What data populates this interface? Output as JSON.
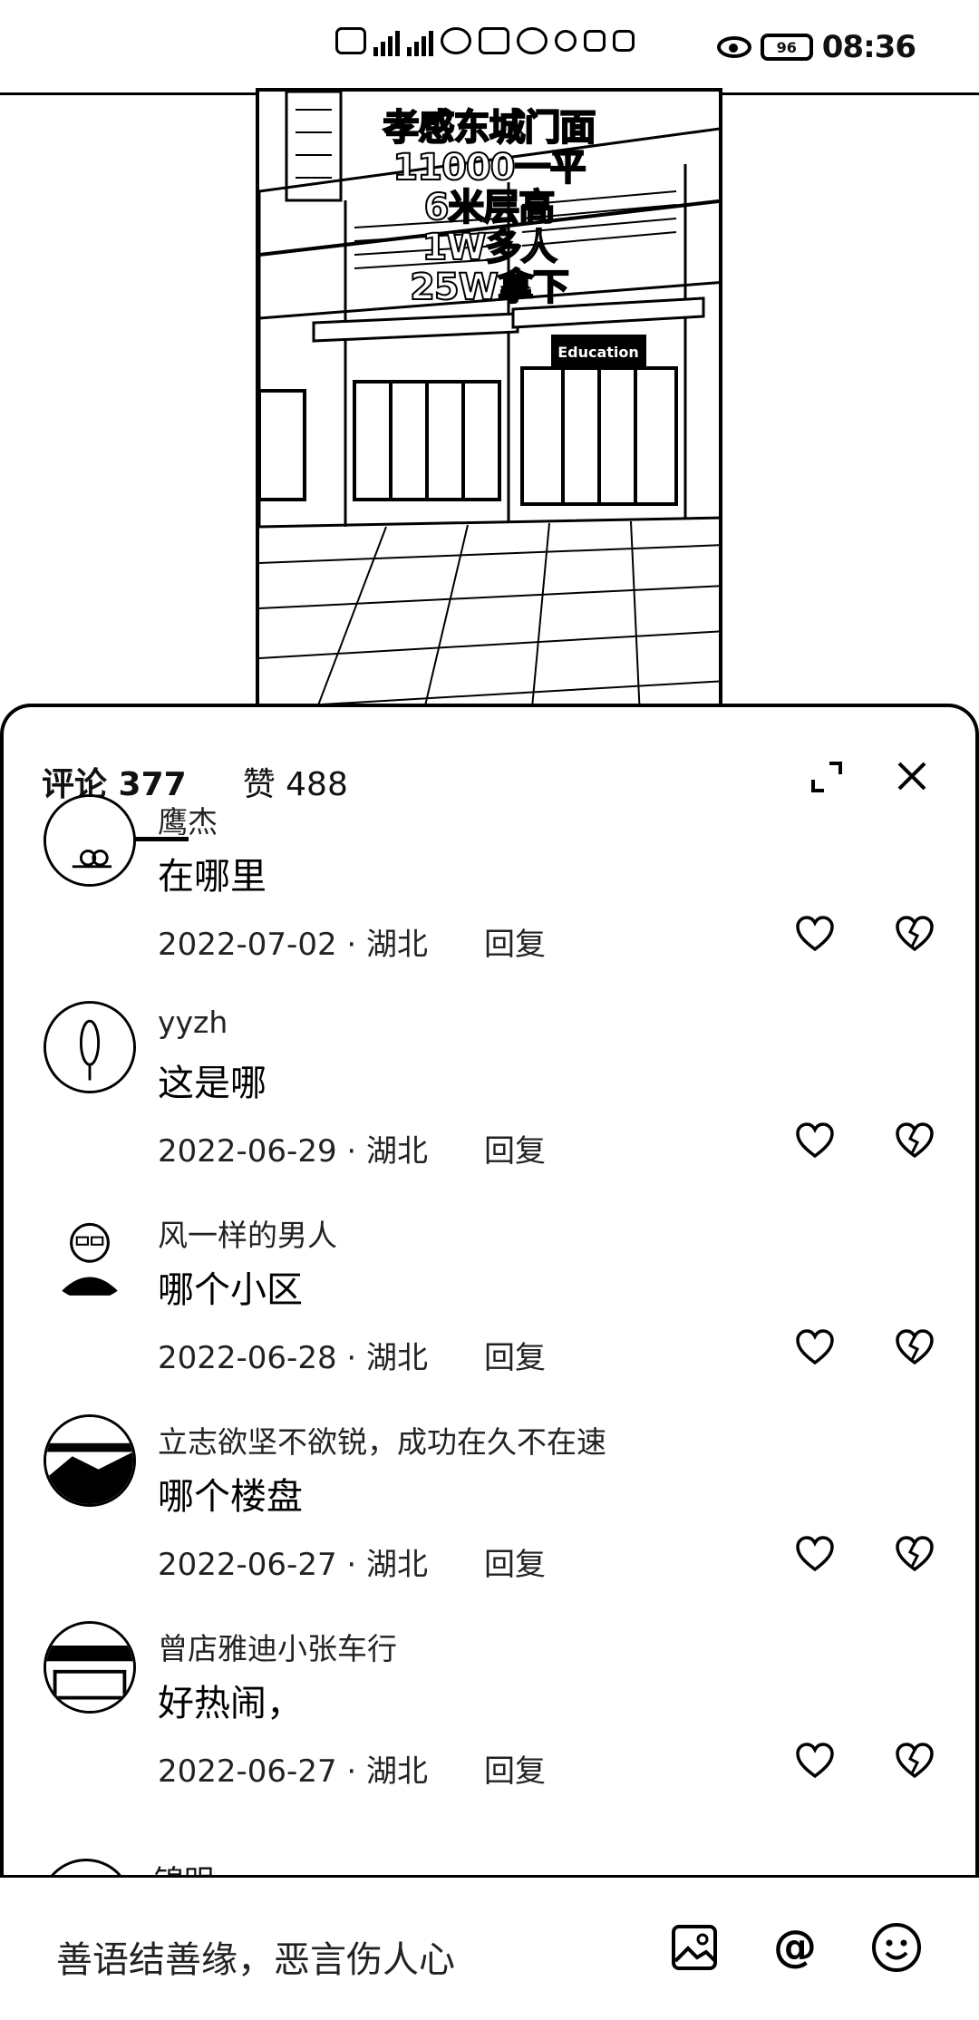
{
  "status_bar": {
    "time": "08:36",
    "battery": "96"
  },
  "video": {
    "caption_lines": [
      "孝感东城门面",
      "11000一平",
      "6米层高",
      "1W多人",
      "25W拿下"
    ],
    "sign_text": "Education"
  },
  "sheet": {
    "comments_tab": "评论 377",
    "likes_tab": "赞 488"
  },
  "comments": [
    {
      "user": "鹰杰",
      "text": "在哪里",
      "meta": "2022-07-02 · 湖北",
      "reply": "回复"
    },
    {
      "user": "yyzh",
      "text": "这是哪",
      "meta": "2022-06-29 · 湖北",
      "reply": "回复"
    },
    {
      "user": "风一样的男人",
      "text": "哪个小区",
      "meta": "2022-06-28 · 湖北",
      "reply": "回复"
    },
    {
      "user": "立志欲坚不欲锐，成功在久不在速",
      "text": "哪个楼盘",
      "meta": "2022-06-27 · 湖北",
      "reply": "回复"
    },
    {
      "user": "曾店雅迪小张车行",
      "text": "好热闹，",
      "meta": "2022-06-27 · 湖北",
      "reply": "回复"
    }
  ],
  "partial_next_user": "锦明",
  "input": {
    "placeholder": "善语结善缘，恶言伤人心"
  }
}
